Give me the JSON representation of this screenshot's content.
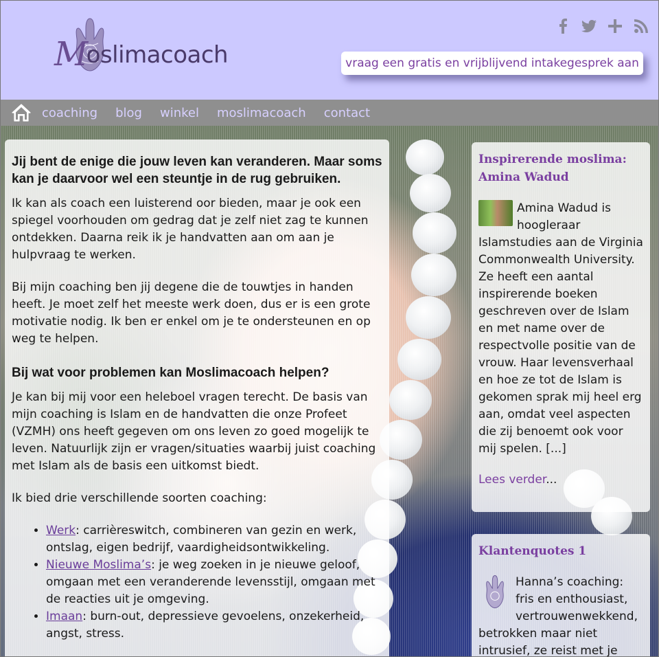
{
  "brand": {
    "logo_text": "Moslimacoach",
    "logo_initial": "M",
    "logo_rest": "oslimacoach"
  },
  "header": {
    "intake_label": "vraag een gratis en vrijblijvend intakegesprek aan",
    "social_icons": [
      "facebook-icon",
      "twitter-icon",
      "google-plus-icon",
      "rss-icon"
    ]
  },
  "nav": {
    "items": [
      "coaching",
      "blog",
      "winkel",
      "moslimacoach",
      "contact"
    ]
  },
  "colors": {
    "header_bg": "#ccc9ff",
    "nav_bg": "#8f8f8f",
    "accent": "#7a3fa0"
  },
  "main": {
    "heading1": "Jij bent de enige die jouw leven kan veranderen. Maar soms kan je daarvoor wel een steuntje in de rug gebruiken.",
    "para1": "Ik kan als coach een luisterend oor bieden, maar je ook een spiegel voorhouden om gedrag dat je zelf niet zag te kunnen ontdekken. Daarna reik ik je handvatten aan om aan je hulpvraag te werken.",
    "para2": "Bij mijn coaching ben jij degene die de touwtjes in handen heeft. Je moet zelf het meeste werk doen, dus er is een grote motivatie nodig. Ik ben er enkel om je te ondersteunen en op weg te helpen.",
    "heading2": "Bij wat voor problemen kan Moslimacoach helpen?",
    "para3": "Je kan bij mij voor een heleboel vragen terecht. De basis van mijn coaching is Islam en de handvatten die onze Profeet (VZMH) ons heeft gegeven om ons leven zo goed mogelijk te leven. Natuurlijk zijn er vragen/situaties waarbij juist coaching met Islam als de basis een uitkomst biedt.",
    "para4": "Ik bied drie verschillende soorten coaching:",
    "list": [
      {
        "link": "Werk",
        "text": ": carrièreswitch, combineren van gezin en werk, ontslag, eigen bedrijf, vaardigheidsontwikkeling."
      },
      {
        "link": "Nieuwe Moslima’s",
        "text": ": je weg zoeken in je nieuwe geloof, omgaan met een veranderende levensstijl, omgaan met de reacties uit je omgeving."
      },
      {
        "link": "Imaan",
        "text": ": burn-out, depressieve gevoelens, onzekerheid, angst, stress."
      }
    ]
  },
  "sidebar": {
    "box1": {
      "title": "Inspirerende moslima: Amina Wadud",
      "text": "Amina Wadud is hoogleraar Islamstudies aan de Virginia Commonwealth University. Ze heeft een aantal inspirerende boeken geschreven over de Islam en met name over de respectvolle positie van de vrouw. Haar levensverhaal en hoe ze tot de Islam is gekomen sprak mij heel erg aan, omdat veel aspecten die zij benoemt ook voor mij spelen. [...]",
      "read_more": "Lees verder",
      "read_more_suffix": "..."
    },
    "box2": {
      "title": "Klantenquotes 1",
      "text": "Hanna’s coaching: fris en enthousiast, vertrouwenwekkend, betrokken maar niet intrusief, ze reist met je mee"
    }
  }
}
